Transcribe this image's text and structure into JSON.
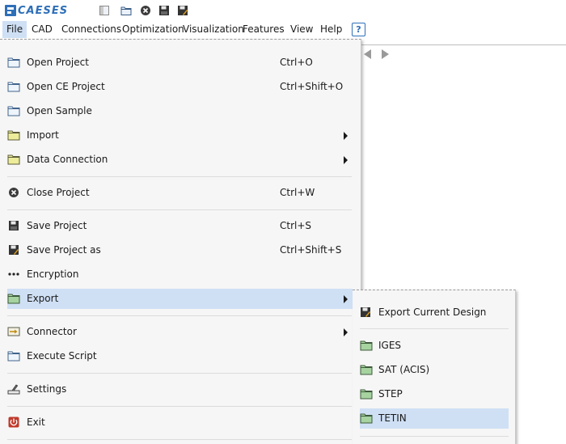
{
  "app": {
    "logo_text": "CAESES"
  },
  "toolbar": {
    "icons": [
      "layout-icon",
      "open-folder-icon",
      "close-circle-icon",
      "save-icon",
      "save-as-icon"
    ]
  },
  "menubar": {
    "items": [
      "File",
      "CAD",
      "Connections",
      "Optimization",
      "Visualization",
      "Features",
      "View",
      "Help"
    ],
    "help_label": "?"
  },
  "file_menu": {
    "open_project": {
      "label": "Open Project",
      "shortcut": "Ctrl+O"
    },
    "open_ce_project": {
      "label": "Open CE Project",
      "shortcut": "Ctrl+Shift+O"
    },
    "open_sample": {
      "label": "Open Sample"
    },
    "import": {
      "label": "Import"
    },
    "data_connection": {
      "label": "Data Connection"
    },
    "close_project": {
      "label": "Close Project",
      "shortcut": "Ctrl+W"
    },
    "save_project": {
      "label": "Save Project",
      "shortcut": "Ctrl+S"
    },
    "save_project_as": {
      "label": "Save Project as",
      "shortcut": "Ctrl+Shift+S"
    },
    "encryption": {
      "label": "Encryption"
    },
    "export": {
      "label": "Export"
    },
    "connector": {
      "label": "Connector"
    },
    "execute_script": {
      "label": "Execute Script"
    },
    "settings": {
      "label": "Settings"
    },
    "exit": {
      "label": "Exit"
    }
  },
  "export_submenu": {
    "export_current_design": "Export Current Design",
    "iges": "IGES",
    "sat": "SAT (ACIS)",
    "step": "STEP",
    "tetin": "TETIN"
  },
  "colors": {
    "highlight": "#cfe0f5",
    "brand": "#2e6fb8",
    "menu_bg": "#f6f6f6"
  }
}
